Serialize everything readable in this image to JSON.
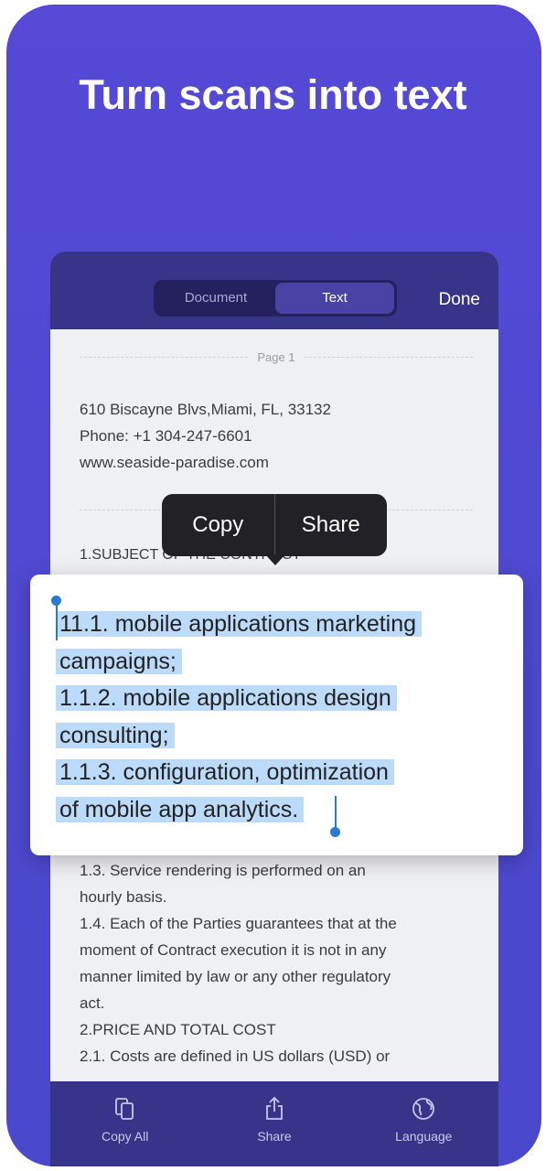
{
  "headline": "Turn scans into text",
  "toolbar": {
    "tabs": [
      {
        "label": "Document",
        "active": false
      },
      {
        "label": "Text",
        "active": true
      }
    ],
    "done": "Done"
  },
  "document": {
    "page_label": "Page 1",
    "address": [
      "610 Biscayne Blvs,Miami, FL, 33132",
      "Phone: +1 304-247-6601",
      "www.seaside-paradise.com"
    ],
    "section": "1.SUBJECT OF THE CONTRACT",
    "body": [
      "1.3. Service rendering is performed on an",
      "hourly basis.",
      "1.4. Each of the Parties guarantees that at the",
      "moment of Contract execution it is not in any",
      "manner limited by law or any other regulatory",
      "act.",
      "2.PRICE AND TOTAL COST",
      "2.1. Costs are defined in US dollars (USD) or"
    ]
  },
  "selection": {
    "lines": [
      "11.1. mobile applications marketing",
      "campaigns;",
      "1.1.2. mobile applications design",
      "consulting;",
      "1.1.3. configuration, optimization",
      "of mobile app analytics."
    ],
    "highlight_color": "#bcdaf9"
  },
  "context_menu": {
    "copy": "Copy",
    "share": "Share"
  },
  "bottom_bar": {
    "items": [
      {
        "label": "Copy All",
        "icon": "copy-all-icon"
      },
      {
        "label": "Share",
        "icon": "share-icon"
      },
      {
        "label": "Language",
        "icon": "globe-icon"
      }
    ]
  },
  "colors": {
    "background": "#5549d6",
    "toolbar": "#38348a",
    "accent": "#2a7ad4"
  }
}
